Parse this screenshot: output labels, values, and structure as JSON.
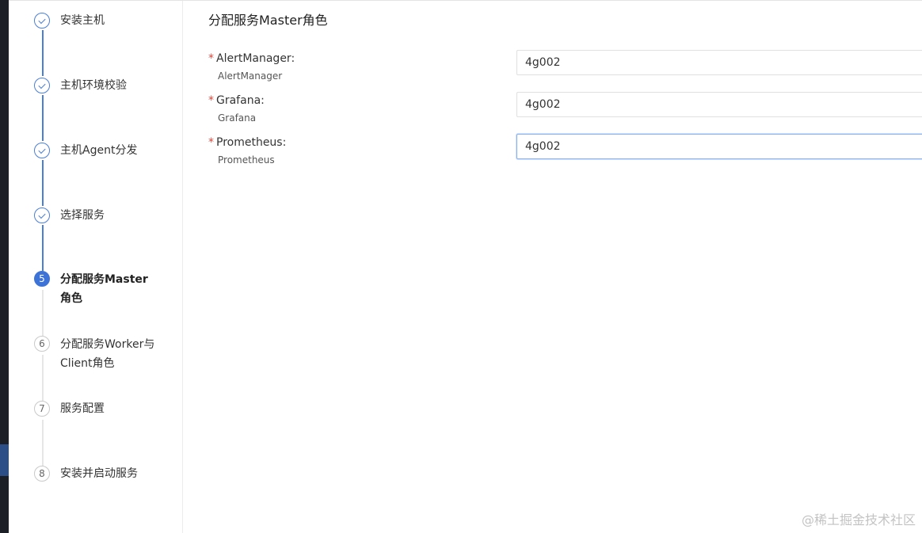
{
  "steps": [
    {
      "number": "1",
      "label": "安装主机",
      "state": "done"
    },
    {
      "number": "2",
      "label": "主机环境校验",
      "state": "done"
    },
    {
      "number": "3",
      "label": "主机Agent分发",
      "state": "done"
    },
    {
      "number": "4",
      "label": "选择服务",
      "state": "done"
    },
    {
      "number": "5",
      "label": "分配服务Master角色",
      "state": "active"
    },
    {
      "number": "6",
      "label": "分配服务Worker与Client角色",
      "state": "todo"
    },
    {
      "number": "7",
      "label": "服务配置",
      "state": "todo"
    },
    {
      "number": "8",
      "label": "安装并启动服务",
      "state": "todo"
    }
  ],
  "main": {
    "title": "分配服务Master角色",
    "fields": [
      {
        "required_mark": "*",
        "label": "AlertManager:",
        "sublabel": "AlertManager",
        "value": "4g002"
      },
      {
        "required_mark": "*",
        "label": "Grafana:",
        "sublabel": "Grafana",
        "value": "4g002"
      },
      {
        "required_mark": "*",
        "label": "Prometheus:",
        "sublabel": "Prometheus",
        "value": "4g002"
      }
    ]
  },
  "watermark": "@稀土掘金技术社区",
  "colors": {
    "accent": "#3d73d6",
    "required": "#e2463a",
    "sidebar_dark": "#1c1f26"
  }
}
